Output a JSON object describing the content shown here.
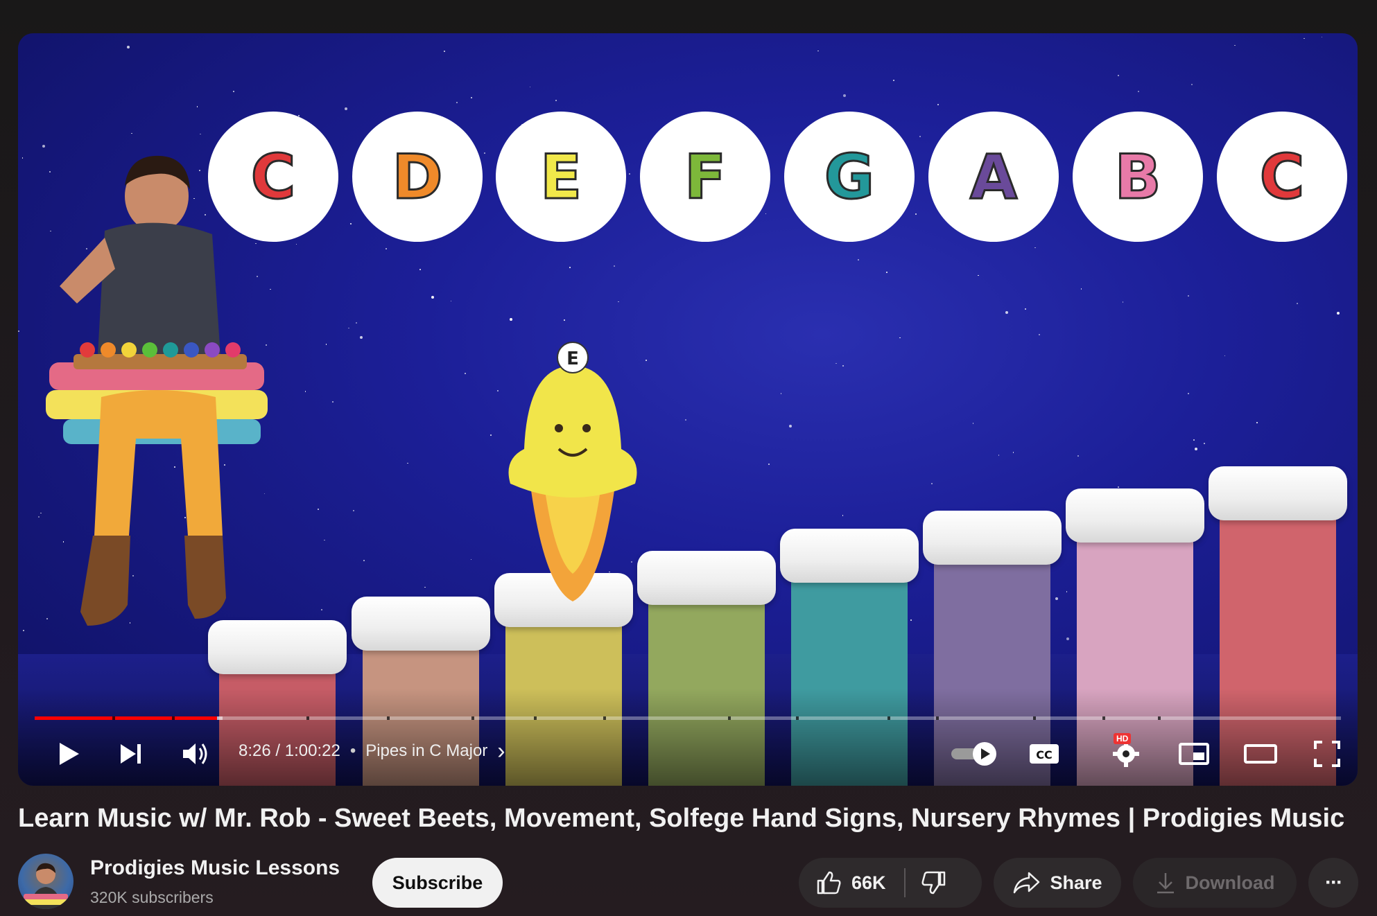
{
  "player": {
    "note_letters": [
      {
        "letter": "C",
        "color": "#e0393b"
      },
      {
        "letter": "D",
        "color": "#ef8a2a"
      },
      {
        "letter": "E",
        "color": "#f1e84a"
      },
      {
        "letter": "F",
        "color": "#7db83a"
      },
      {
        "letter": "G",
        "color": "#23989a"
      },
      {
        "letter": "A",
        "color": "#6a4a9a"
      },
      {
        "letter": "B",
        "color": "#e87aa8"
      },
      {
        "letter": "C",
        "color": "#e0393b"
      }
    ],
    "pipe_colors": [
      "#c65c66",
      "#c69480",
      "#cdbf5a",
      "#93a85e",
      "#3f9ba0",
      "#7f6ea0",
      "#d8a4c0",
      "#d0646c"
    ],
    "mascot_letter": "E",
    "progress": 0.1398,
    "controls": {
      "time_current": "8:26",
      "time_separator": "/",
      "time_total": "1:00:22",
      "chapter_dot": "•",
      "chapter_title": "Pipes in C Major",
      "chapter_chevron": "›",
      "hd_label": "HD",
      "icons": [
        "play-icon",
        "next-icon",
        "volume-icon",
        "autoplay-toggle-icon",
        "captions-icon",
        "settings-icon",
        "miniplayer-icon",
        "theater-mode-icon",
        "fullscreen-icon"
      ]
    }
  },
  "video": {
    "title": "Learn Music w/ Mr. Rob - Sweet Beets, Movement, Solfege Hand Signs, Nursery Rhymes | Prodigies Music"
  },
  "channel": {
    "name": "Prodigies Music Lessons",
    "subscribers": "320K subscribers"
  },
  "actions": {
    "subscribe_label": "Subscribe",
    "like_count": "66K",
    "share_label": "Share",
    "download_label": "Download",
    "more_label": "···"
  }
}
